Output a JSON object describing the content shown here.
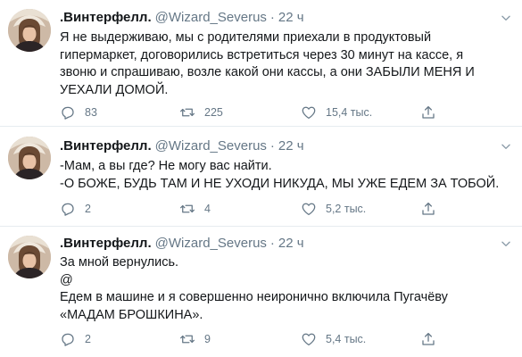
{
  "colors": {
    "text": "#14171a",
    "secondary": "#657786",
    "divider": "#e6ecf0"
  },
  "icons": {
    "reply": "reply-icon",
    "retweet": "retweet-icon",
    "like": "heart-icon",
    "share": "share-icon",
    "more": "chevron-down-icon"
  },
  "tweets": [
    {
      "name": ".Винтерфелл.",
      "handle": "@Wizard_Severus",
      "dot": "·",
      "time": "22 ч",
      "text": "Я не выдерживаю, мы с родителями приехали в продуктовый\nгипермаркет, договорились встретиться через 30 минут на кассе, я\nзвоню и спрашиваю, возле какой они кассы, а они ЗАБЫЛИ МЕНЯ И\nУЕХАЛИ ДОМОЙ.",
      "replies": "83",
      "retweets": "225",
      "likes": "15,4 тыс."
    },
    {
      "name": ".Винтерфелл.",
      "handle": "@Wizard_Severus",
      "dot": "·",
      "time": "22 ч",
      "text": "-Мам, а вы где? Не могу вас найти.\n-О БОЖЕ, БУДЬ ТАМ И НЕ УХОДИ НИКУДА, МЫ УЖЕ ЕДЕМ ЗА ТОБОЙ.",
      "replies": "2",
      "retweets": "4",
      "likes": "5,2 тыс."
    },
    {
      "name": ".Винтерфелл.",
      "handle": "@Wizard_Severus",
      "dot": "·",
      "time": "22 ч",
      "text": "За мной вернулись.\n@\nЕдем в машине и я совершенно неиронично включила Пугачёву\n«МАДАМ БРОШКИНА».",
      "replies": "2",
      "retweets": "9",
      "likes": "5,4 тыс."
    }
  ]
}
